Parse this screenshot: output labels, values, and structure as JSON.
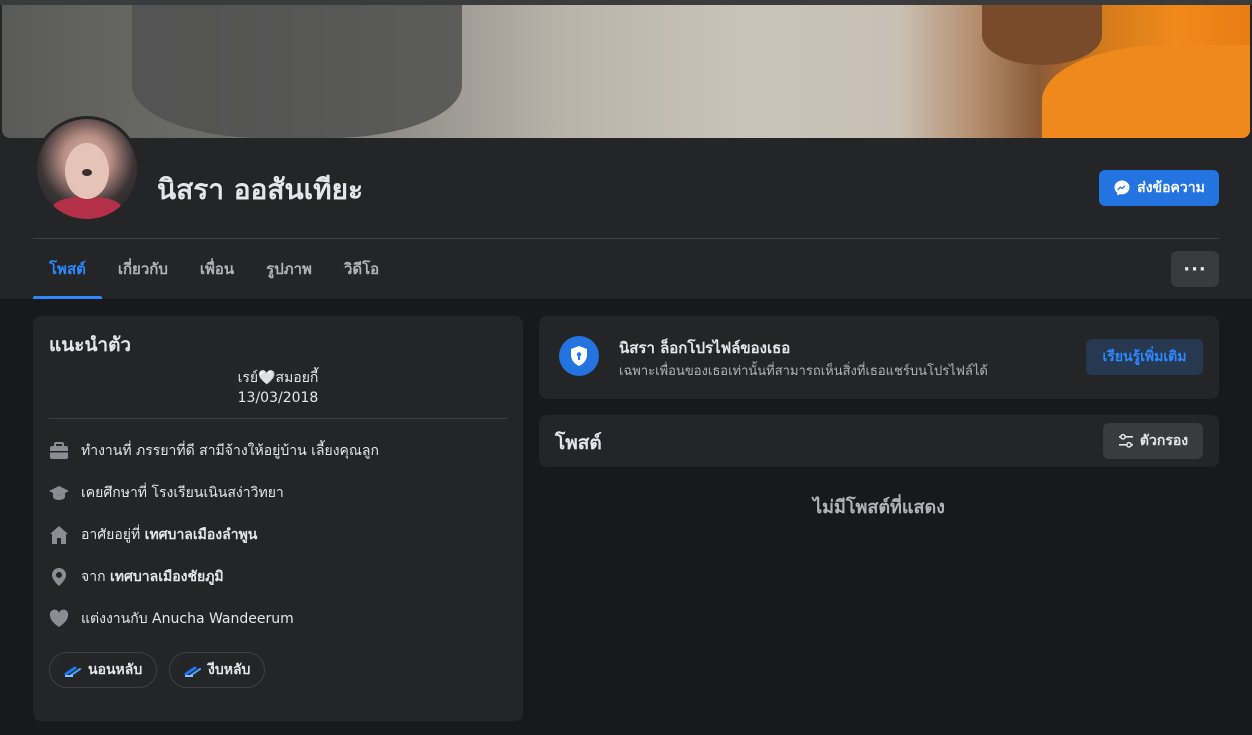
{
  "profile": {
    "name": "นิสรา ออสันเทียะ",
    "message_button": "ส่งข้อความ"
  },
  "tabs": [
    {
      "label": "โพสต์",
      "active": true
    },
    {
      "label": "เกี่ยวกับ",
      "active": false
    },
    {
      "label": "เพื่อน",
      "active": false
    },
    {
      "label": "รูปภาพ",
      "active": false
    },
    {
      "label": "วิดีโอ",
      "active": false
    }
  ],
  "more_button": "···",
  "intro": {
    "title": "แนะนำตัว",
    "bio_line1": "เรย์🤍สมอยกี้",
    "bio_line2": "13/03/2018",
    "work": {
      "prefix": "ทำงานที่",
      "value": "ภรรยาที่ดี สามีจ้างให้อยู่บ้าน เลี้ยงคุณลูก"
    },
    "education": {
      "prefix": "เคยศึกษาที่",
      "value": "โรงเรียนเนินสง่าวิทยา"
    },
    "lives": {
      "prefix": "อาศัยอยู่ที่",
      "value": "เทศบาลเมืองลำพูน"
    },
    "from": {
      "prefix": "จาก",
      "value": "เทศบาลเมืองชัยภูมิ"
    },
    "relationship": {
      "prefix": "แต่งงานกับ",
      "value": "Anucha Wandeerum"
    },
    "hobbies": [
      "นอนหลับ",
      "งีบหลับ"
    ]
  },
  "locked": {
    "title": "นิสรา ล็อกโปรไฟล์ของเธอ",
    "subtitle": "เฉพาะเพื่อนของเธอเท่านั้นที่สามารถเห็นสิ่งที่เธอแชร์บนโปรไฟล์ได้",
    "button": "เรียนรู้เพิ่มเติม"
  },
  "posts": {
    "title": "โพสต์",
    "filter_button": "ตัวกรอง",
    "empty_text": "ไม่มีโพสต์ที่แสดง"
  },
  "colors": {
    "background": "#18191a",
    "card": "#242526",
    "accent": "#2d88ff",
    "primary_button": "#2374e1"
  }
}
